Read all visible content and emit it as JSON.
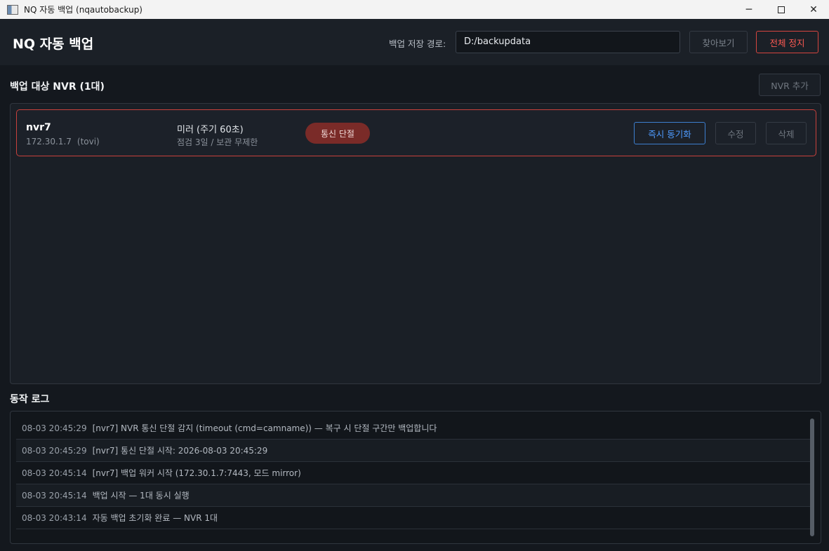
{
  "window": {
    "title": "NQ 자동 백업 (nqautobackup)",
    "controls": {
      "minimize": "─",
      "close": "✕"
    }
  },
  "header": {
    "app_title": "NQ 자동 백업",
    "path_label": "백업 저장 경로:",
    "path_value": "D:/backupdata",
    "browse_label": "찾아보기",
    "stop_all_label": "전체 정지"
  },
  "nvr_section": {
    "title": "백업 대상 NVR (1대)",
    "add_label": "NVR 추가",
    "items": [
      {
        "name": "nvr7",
        "ip": "172.30.1.7",
        "user": "(tovi)",
        "mode": "미러 (주기 60초)",
        "schedule": "점검 3일 / 보관 무제한",
        "status": "통신 단절",
        "sync_label": "즉시 동기화",
        "edit_label": "수정",
        "delete_label": "삭제"
      }
    ]
  },
  "log_section": {
    "title": "동작 로그",
    "entries": [
      {
        "time": "08-03 20:45:29",
        "message": "[nvr7]  NVR 통신 단절 감지 (timeout (cmd=camname)) — 복구 시 단절 구간만 백업합니다"
      },
      {
        "time": "08-03 20:45:29",
        "message": "[nvr7]  통신 단절 시작: 2026-08-03 20:45:29"
      },
      {
        "time": "08-03 20:45:14",
        "message": "[nvr7]  백업 워커 시작 (172.30.1.7:7443, 모드 mirror)"
      },
      {
        "time": "08-03 20:45:14",
        "message": "백업 시작 — 1대 동시 실행"
      },
      {
        "time": "08-03 20:43:14",
        "message": "자동 백업 초기화 완료 — NVR 1대"
      }
    ]
  },
  "colors": {
    "accent_blue": "#4e9bff",
    "danger_red": "#ff5a52",
    "status_offline_bg": "#7a2b28"
  }
}
